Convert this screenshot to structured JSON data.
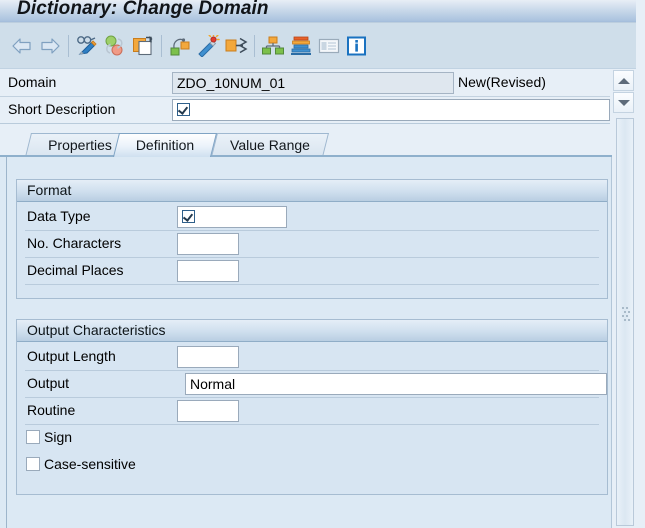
{
  "window": {
    "title": "Dictionary: Change Domain"
  },
  "toolbar": {
    "items": [
      {
        "name": "back-arrow-icon",
        "label": "Back"
      },
      {
        "name": "forward-arrow-icon",
        "label": "Forward"
      },
      {
        "name": "separator-1",
        "label": ""
      },
      {
        "name": "display-change-icon",
        "label": "Display <-> Change"
      },
      {
        "name": "check-syntax-icon",
        "label": "Check"
      },
      {
        "name": "copy-object-icon",
        "label": "Copy"
      },
      {
        "name": "separator-2",
        "label": ""
      },
      {
        "name": "where-used-list-icon",
        "label": "Where-Used List"
      },
      {
        "name": "generate-icon",
        "label": "Activate"
      },
      {
        "name": "transport-icon",
        "label": "Transport"
      },
      {
        "name": "separator-3",
        "label": ""
      },
      {
        "name": "hierarchy-icon",
        "label": "Hierarchy"
      },
      {
        "name": "stack-layers-icon",
        "label": "Layers"
      },
      {
        "name": "table-view-icon",
        "label": "Table View"
      },
      {
        "name": "information-icon",
        "label": "Information"
      }
    ]
  },
  "header": {
    "domain_label": "Domain",
    "domain_value": "ZDO_10NUM_01",
    "status": "New(Revised)",
    "short_description_label": "Short Description",
    "short_description_value": "",
    "short_description_placeholder": ""
  },
  "tabs": [
    {
      "label": "Properties",
      "active": false
    },
    {
      "label": "Definition",
      "active": true
    },
    {
      "label": "Value Range",
      "active": false
    }
  ],
  "format_section": {
    "title": "Format",
    "rows": [
      {
        "label": "Data Type",
        "value": "",
        "field": "wide"
      },
      {
        "label": "No. Characters",
        "value": "",
        "field": "narrow"
      },
      {
        "label": "Decimal Places",
        "value": "",
        "field": "narrow"
      }
    ]
  },
  "output_section": {
    "title": "Output Characteristics",
    "rows": [
      {
        "label": "Output Length",
        "value": "",
        "field": "narrow"
      },
      {
        "label": "Output",
        "value": "Normal",
        "field": "full"
      },
      {
        "label": "Routine",
        "value": "",
        "field": "narrow"
      }
    ],
    "checkboxes": [
      {
        "label": "Sign",
        "checked": false
      },
      {
        "label": "Case-sensitive",
        "checked": false
      }
    ]
  },
  "scrollbar": {
    "up_label": "Scroll up",
    "down_label": "Scroll down"
  },
  "colors": {
    "title_bar_top": "#e8eef6",
    "title_bar_bottom": "#9fb9d8",
    "toolbar_bg": "#cfdeea",
    "body_bg": "#dce9f4",
    "panel_bg": "#d7e5f2",
    "panel_header": "#cfdfee",
    "field_border": "#9aaabb",
    "text": "#000000"
  }
}
